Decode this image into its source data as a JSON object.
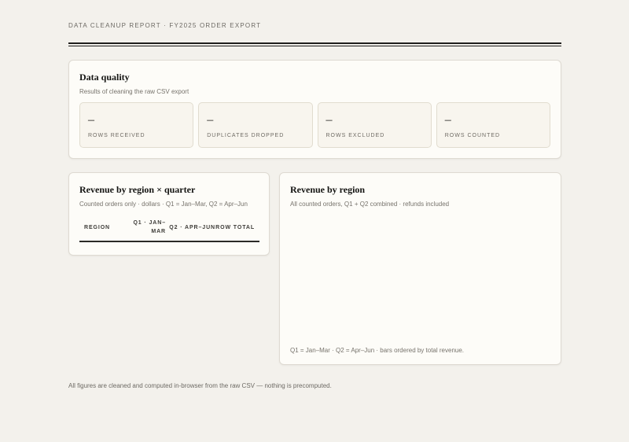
{
  "header": {
    "eyebrow": "DATA CLEANUP REPORT · FY2025 ORDER EXPORT"
  },
  "data_quality": {
    "title": "Data quality",
    "subtitle": "Results of cleaning the raw CSV export",
    "stats": [
      {
        "value": "–",
        "label": "ROWS RECEIVED"
      },
      {
        "value": "–",
        "label": "DUPLICATES DROPPED"
      },
      {
        "value": "–",
        "label": "ROWS EXCLUDED"
      },
      {
        "value": "–",
        "label": "ROWS COUNTED"
      }
    ]
  },
  "revenue_table": {
    "title": "Revenue by region × quarter",
    "subtitle": "Counted orders only · dollars · Q1 = Jan–Mar, Q2 = Apr–Jun",
    "columns": [
      "REGION",
      "Q1 · JAN–MAR",
      "Q2 · APR–JUN",
      "ROW TOTAL"
    ],
    "rows": []
  },
  "revenue_chart": {
    "title": "Revenue by region",
    "subtitle": "All counted orders, Q1 + Q2 combined · refunds included",
    "footnote": "Q1 = Jan–Mar · Q2 = Apr–Jun · bars ordered by total revenue."
  },
  "footer": {
    "note": "All figures are cleaned and computed in-browser from the raw CSV — nothing is precomputed."
  }
}
